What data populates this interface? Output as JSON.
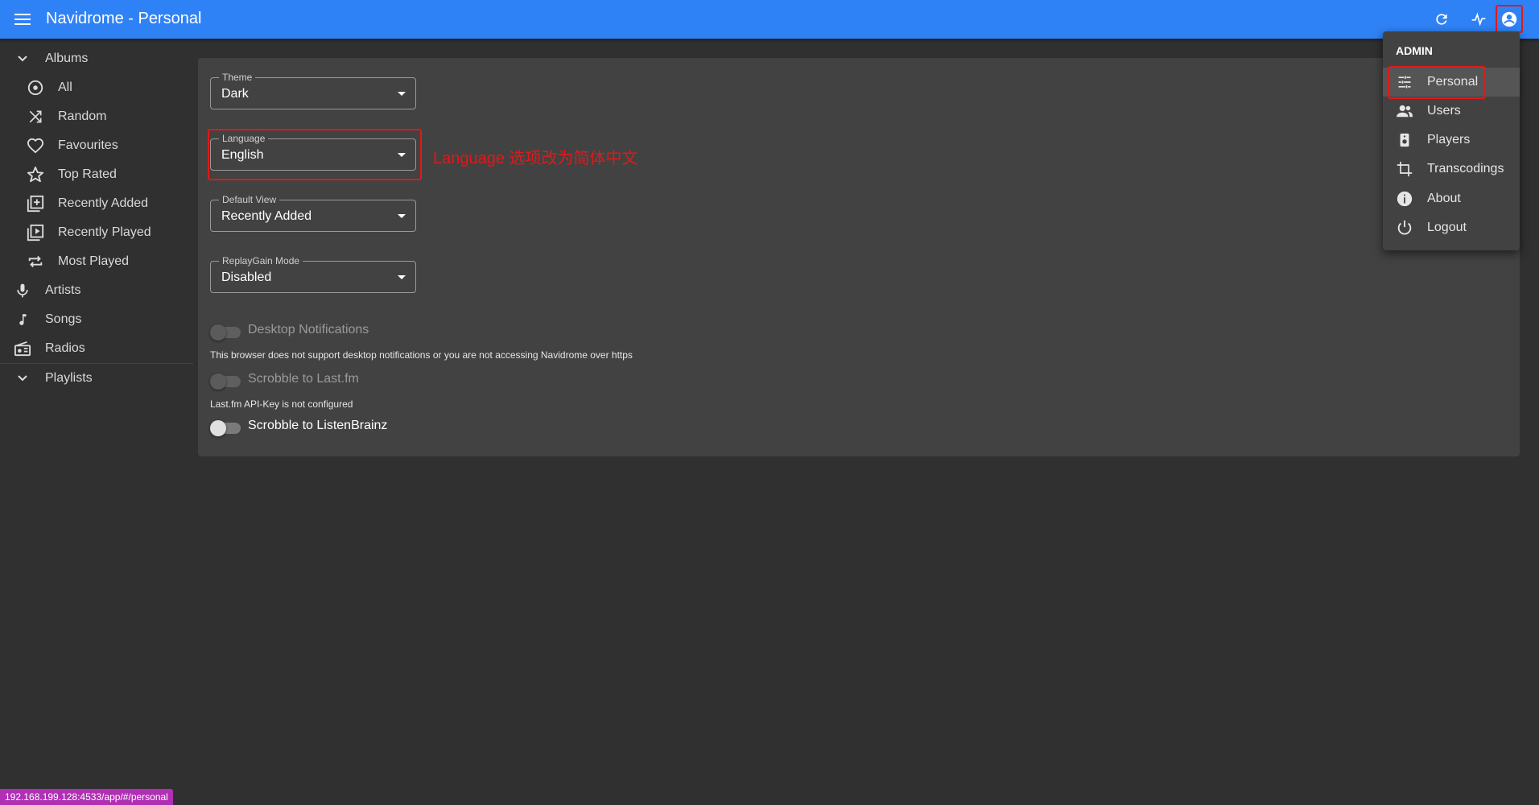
{
  "app": {
    "title": "Navidrome - Personal"
  },
  "sidebar": {
    "albums_label": "Albums",
    "album_items": [
      "All",
      "Random",
      "Favourites",
      "Top Rated",
      "Recently Added",
      "Recently Played",
      "Most Played"
    ],
    "artists_label": "Artists",
    "songs_label": "Songs",
    "radios_label": "Radios",
    "playlists_label": "Playlists"
  },
  "settings": {
    "theme": {
      "label": "Theme",
      "value": "Dark"
    },
    "language": {
      "label": "Language",
      "value": "English"
    },
    "default_view": {
      "label": "Default View",
      "value": "Recently Added"
    },
    "replaygain": {
      "label": "ReplayGain Mode",
      "value": "Disabled"
    },
    "desktop_notifications": {
      "label": "Desktop Notifications",
      "helper": "This browser does not support desktop notifications or you are not accessing Navidrome over https",
      "enabled": false
    },
    "scrobble_lastfm": {
      "label": "Scrobble to Last.fm",
      "helper": "Last.fm API-Key is not configured",
      "enabled": false
    },
    "scrobble_listenbrainz": {
      "label": "Scrobble to ListenBrainz",
      "enabled": false
    }
  },
  "annotation": "Language 选项改为简体中文",
  "user_menu": {
    "header": "ADMIN",
    "items": [
      "Personal",
      "Users",
      "Players",
      "Transcodings",
      "About",
      "Logout"
    ],
    "active": "Personal"
  },
  "status_bar": {
    "url": "192.168.199.128:4533/app/#/personal"
  },
  "colors": {
    "appbar": "#2f82f6",
    "annotation": "#e0191a",
    "background": "#303030",
    "panel": "#424242"
  }
}
